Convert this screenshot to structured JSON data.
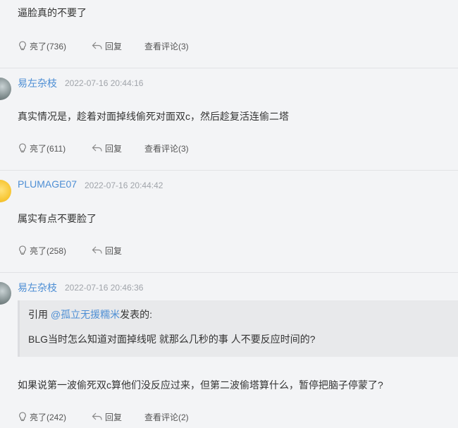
{
  "comments": [
    {
      "user": "",
      "time": "",
      "text": "逼脸真的不要了",
      "like_label": "亮了(736)",
      "reply_label": "回复",
      "view_label": "查看评论(3)"
    },
    {
      "user": "易左杂枝",
      "time": "2022-07-16 20:44:16",
      "text": "真实情况是，趁着对面掉线偷死对面双c，然后趁复活连偷二塔",
      "like_label": "亮了(611)",
      "reply_label": "回复",
      "view_label": "查看评论(3)"
    },
    {
      "user": "PLUMAGE07",
      "time": "2022-07-16 20:44:42",
      "text": "属实有点不要脸了",
      "like_label": "亮了(258)",
      "reply_label": "回复"
    },
    {
      "user": "易左杂枝",
      "time": "2022-07-16 20:46:36",
      "quote": {
        "prefix": "引用 ",
        "mention": "@孤立无援糯米",
        "suffix": "发表的:",
        "body": "BLG当时怎么知道对面掉线呢 就那么几秒的事 人不要反应时间的?"
      },
      "text": "如果说第一波偷死双c算他们没反应过来，但第二波偷塔算什么，暂停把脑子停蒙了?",
      "like_label": "亮了(242)",
      "reply_label": "回复",
      "view_label": "查看评论(2)"
    }
  ],
  "icons": {
    "like": "lightbulb-icon",
    "reply": "reply-arrow-icon"
  },
  "colors": {
    "background": "#f3f4f6",
    "username": "#4d8ed4",
    "timestamp": "#a0a4aa",
    "quote_bg": "#e8e9eb"
  }
}
